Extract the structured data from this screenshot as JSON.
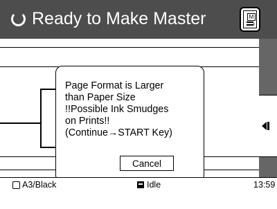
{
  "header": {
    "title": "Ready to Make Master",
    "master_button_letter": "M"
  },
  "dialog": {
    "lines": [
      "Page Format is Larger",
      "than Paper Size",
      "!!Possible Ink Smudges",
      "on Prints!!",
      "(Continue→START Key)"
    ],
    "cancel_label": "Cancel"
  },
  "status": {
    "paper": "A3/Black",
    "state": "Idle",
    "time": "13:59"
  },
  "icons": {
    "spinner": "busy-spinner-icon",
    "master": "make-master-icon",
    "tab_arrow": "chevron-left-icon",
    "paper": "paper-tray-icon",
    "idle": "status-idle-icon"
  }
}
